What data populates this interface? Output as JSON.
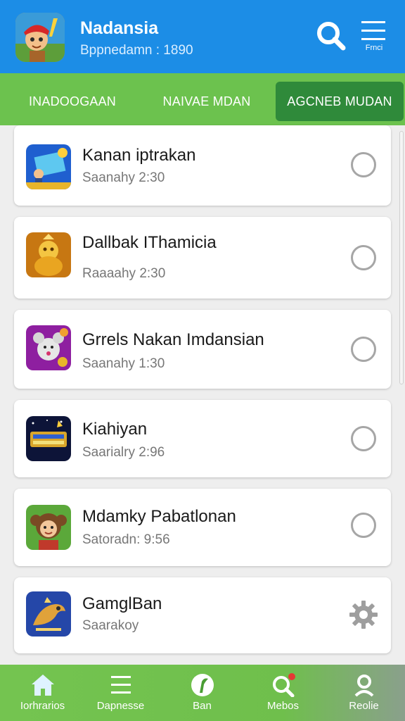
{
  "header": {
    "title": "Nadansia",
    "subtitle": "Bppnedamn : 1890",
    "menu_label": "Frnci",
    "app_icon": "pirate-boy-app-icon",
    "search_icon": "search-icon",
    "menu_icon": "hamburger-menu-icon"
  },
  "tabs": [
    {
      "label": "INADOOGAAN",
      "active": false
    },
    {
      "label": "NAIVAE MDAN",
      "active": false
    },
    {
      "label": "AGCNEB MUDAN",
      "active": true
    }
  ],
  "games": [
    {
      "title": "Kanan iptrakan",
      "subtitle": "Saanahy 2:30",
      "icon": "slot-reel-game-icon",
      "action": "radio"
    },
    {
      "title": "Dallbak IThamicia",
      "subtitle": "Raaaahy 2:30",
      "icon": "golden-idol-game-icon",
      "action": "radio"
    },
    {
      "title": "Grrels Nakan Imdansian",
      "subtitle": "Saanahy 1:30",
      "icon": "mouse-character-game-icon",
      "action": "radio"
    },
    {
      "title": "Kiahiyan",
      "subtitle": "Saarialry 2:96",
      "icon": "starry-slots-game-icon",
      "action": "radio"
    },
    {
      "title": "Mdamky Pabatlonan",
      "subtitle": "Satoradn: 9:56",
      "icon": "monkey-girl-game-icon",
      "action": "radio"
    },
    {
      "title": "GamglBan",
      "subtitle": "Saarakoy",
      "icon": "dragon-game-icon",
      "action": "settings"
    }
  ],
  "bottom_nav": [
    {
      "label": "Iorhrarios",
      "icon": "home-icon"
    },
    {
      "label": "Dapnesse",
      "icon": "list-icon"
    },
    {
      "label": "Ban",
      "icon": "leaf-icon"
    },
    {
      "label": "Mebos",
      "icon": "search-notification-icon",
      "badge": true
    },
    {
      "label": "Reolie",
      "icon": "profile-icon"
    }
  ],
  "colors": {
    "header_blue": "#1c8de6",
    "tab_green": "#6cc24e",
    "active_tab": "#2f8a3a",
    "badge_red": "#e53935"
  }
}
